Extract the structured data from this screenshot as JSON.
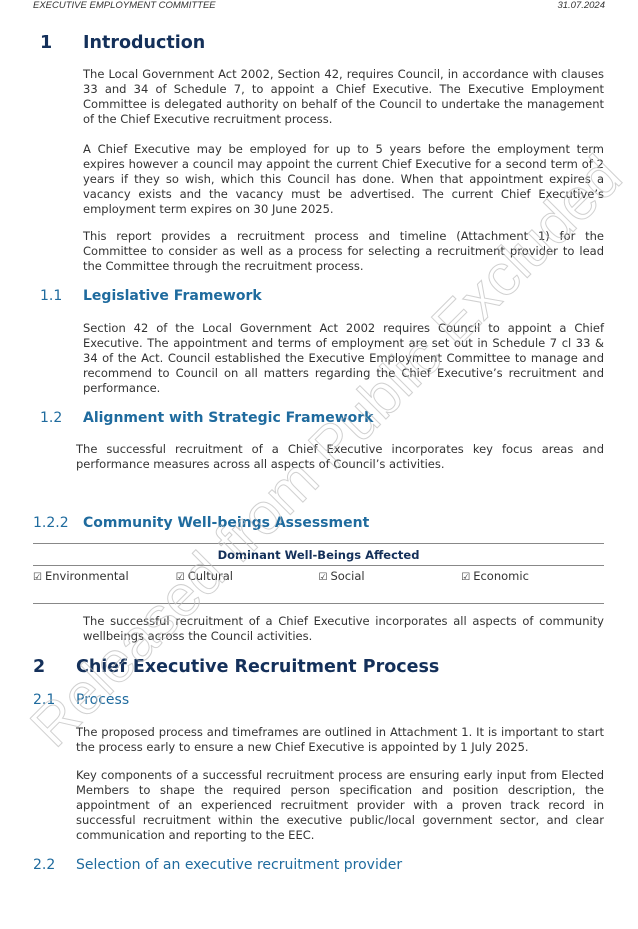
{
  "header": {
    "committee": "EXECUTIVE EMPLOYMENT COMMITTEE",
    "date": "31.07.2024"
  },
  "sections": {
    "s1": {
      "num": "1",
      "title": "Introduction",
      "paragraphs": [
        "The Local Government Act 2002, Section 42, requires Council, in accordance with clauses 33 and 34 of Schedule 7, to appoint a Chief Executive. The Executive Employment Committee is delegated authority on behalf of the Council to undertake the management of the Chief Executive recruitment process.",
        "A Chief Executive may be employed for up to 5 years before the employment term expires however a council may appoint the current Chief Executive for a second term of 2 years if they so wish, which this Council has done. When that appointment expires a vacancy exists and the vacancy must be advertised. The current Chief Executive’s employment term expires on 30 June 2025.",
        "This report provides a recruitment process and timeline (Attachment 1) for the Committee to consider as well as a process for selecting a recruitment provider to lead the Committee through the recruitment process."
      ]
    },
    "s1_1": {
      "num": "1.1",
      "title": "Legislative Framework",
      "paragraph": "Section 42 of the Local Government Act 2002 requires Council to appoint a Chief Executive. The appointment and terms of employment are set out in Schedule 7 cl 33 & 34 of the Act. Council established the Executive Employment Committee to manage and recommend to Council on all matters regarding the Chief Executive’s recruitment and performance."
    },
    "s1_2": {
      "num": "1.2",
      "title": "Alignment with Strategic Framework",
      "paragraph": "The successful recruitment of a Chief Executive incorporates key focus areas and performance measures across all aspects of Council’s activities."
    },
    "s1_2_2": {
      "num": "1.2.2",
      "title": "Community Well-beings Assessment",
      "table_header": "Dominant Well-Beings Affected",
      "checkbox_glyph": "☑",
      "wellbeings": [
        {
          "label": "Environmental",
          "checked": true
        },
        {
          "label": "Cultural",
          "checked": true
        },
        {
          "label": "Social",
          "checked": true
        },
        {
          "label": "Economic",
          "checked": true
        }
      ],
      "paragraph": "The successful recruitment of a Chief Executive incorporates all aspects of community wellbeings across the Council activities."
    },
    "s2": {
      "num": "2",
      "title": "Chief Executive Recruitment Process"
    },
    "s2_1": {
      "num": "2.1",
      "title": "Process",
      "paragraphs": [
        "The proposed process and timeframes are outlined in Attachment 1. It is important to start the process early to ensure a new Chief Executive is appointed by 1 July 2025.",
        "Key components of a successful recruitment process are ensuring early input from Elected Members to shape the required person specification and position description, the appointment of an experienced recruitment provider with a proven track record in successful recruitment within the executive public/local government sector, and clear communication and reporting to the EEC."
      ]
    },
    "s2_2": {
      "num": "2.2",
      "title": "Selection of an executive recruitment provider"
    }
  },
  "watermark": {
    "text": "Released from Public Excluded"
  }
}
